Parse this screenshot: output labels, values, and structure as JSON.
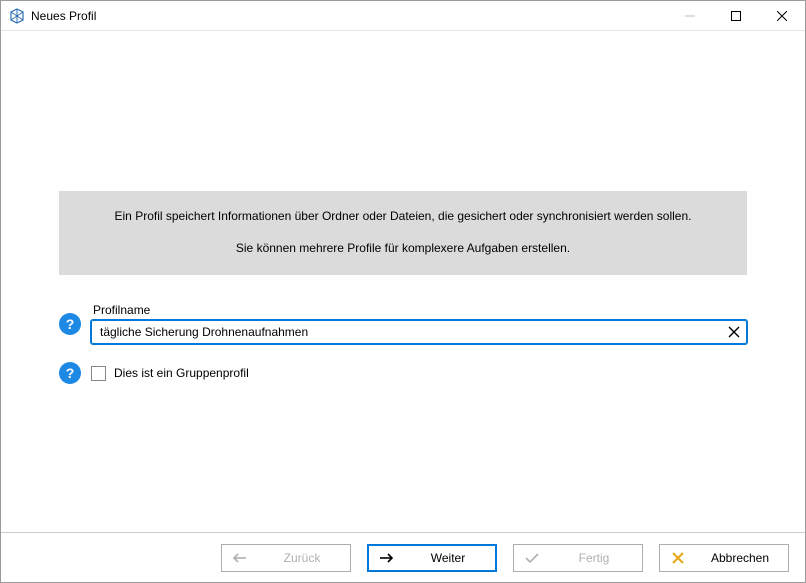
{
  "window": {
    "title": "Neues Profil"
  },
  "info": {
    "line1": "Ein Profil speichert Informationen über Ordner oder Dateien, die gesichert oder synchronisiert werden sollen.",
    "line2": "Sie können mehrere Profile für komplexere Aufgaben erstellen."
  },
  "form": {
    "profilname_label": "Profilname",
    "profilname_value": "tägliche Sicherung Drohnenaufnahmen",
    "group_profile_label": "Dies ist ein Gruppenprofil",
    "group_profile_checked": false
  },
  "buttons": {
    "back": "Zurück",
    "next": "Weiter",
    "finish": "Fertig",
    "cancel": "Abbrechen"
  }
}
